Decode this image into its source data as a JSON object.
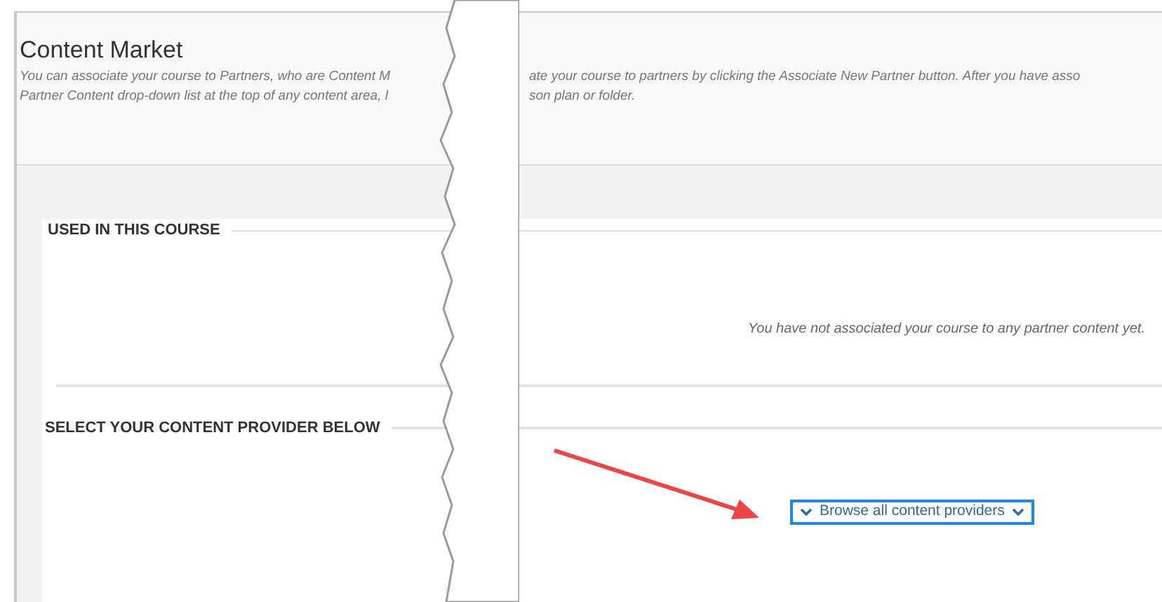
{
  "title": "Content Market",
  "description": [
    {
      "left": "You can associate your course to Partners, who are Content M",
      "right": "ate your course to partners by clicking the Associate New Partner button. After you have asso"
    },
    {
      "left": "Partner Content drop-down list at the top of any content area, l",
      "right": "son plan or folder."
    }
  ],
  "used_section": {
    "heading": "USED IN THIS COURSE",
    "message": "You have not associated your course to any partner content yet."
  },
  "provider_section": {
    "heading": "SELECT YOUR CONTENT PROVIDER BELOW",
    "button": "Browse all content providers"
  }
}
